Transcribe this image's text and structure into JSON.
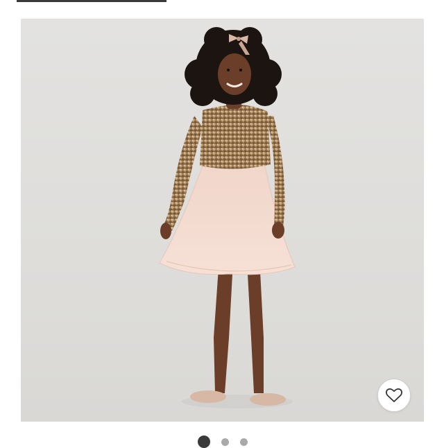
{
  "product_image": {
    "icon": "product-photo",
    "subject_colors": {
      "backdrop": "#e0dfdc",
      "bodice": "#b89468",
      "skirt": "#f2d3c6",
      "shoes": "#d7b8a4",
      "skin": "#6b3e2a",
      "hair": "#1c1410"
    }
  },
  "favorite": {
    "icon": "heart-icon"
  },
  "carousel": {
    "count": 3,
    "active_index": 0
  },
  "colors": {
    "active_dot": "#3a3a3a",
    "inactive_dot": "#a9a9a9",
    "heart_stroke": "#333333"
  }
}
